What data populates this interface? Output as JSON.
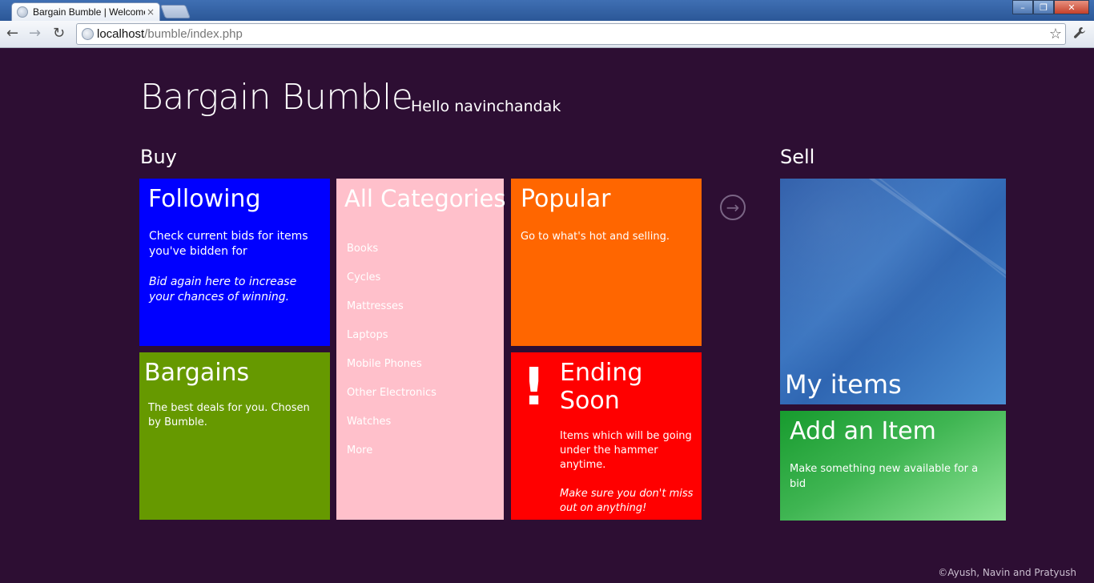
{
  "browser": {
    "tab_title": "Bargain Bumble | Welcome",
    "tab_close": "×",
    "url_host": "localhost",
    "url_path": "/bumble/index.php",
    "back": "←",
    "forward": "→",
    "reload": "↻",
    "star": "☆",
    "wrench": "🔧",
    "window": {
      "minimize": "–",
      "maximize": "❐",
      "close": "✕"
    }
  },
  "header": {
    "title": "Bargain Bumble",
    "greeting": "Hello navinchandak"
  },
  "sections": {
    "buy": "Buy",
    "sell": "Sell"
  },
  "tiles": {
    "following": {
      "title": "Following",
      "desc": "Check current bids for items you've bidden for",
      "note": "Bid again here to increase your chances of winning.",
      "color": "#0000ff"
    },
    "bargains": {
      "title": "Bargains",
      "desc": "The best deals for you. Chosen by Bumble.",
      "color": "#669900"
    },
    "categories": {
      "title": "All Categories",
      "items": [
        "Books",
        "Cycles",
        "Mattresses",
        "Laptops",
        "Mobile Phones",
        "Other Electronics",
        "Watches",
        "More"
      ],
      "color": "#ffc0cb"
    },
    "popular": {
      "title": "Popular",
      "desc": "Go to what's hot and selling.",
      "color": "#ff6600"
    },
    "ending_soon": {
      "title": "Ending Soon",
      "icon": "!",
      "desc": "Items which will be going under the hammer anytime.",
      "note": "Make sure you don't miss out on anything!",
      "color": "#ff0000"
    },
    "my_items": {
      "title": "My items",
      "color": "#3b75c0"
    },
    "add_item": {
      "title": "Add an Item",
      "desc": "Make something new available for a bid",
      "color": "#3fb552"
    }
  },
  "nav_arrow": "→",
  "footer": "©Ayush, Navin and Pratyush"
}
